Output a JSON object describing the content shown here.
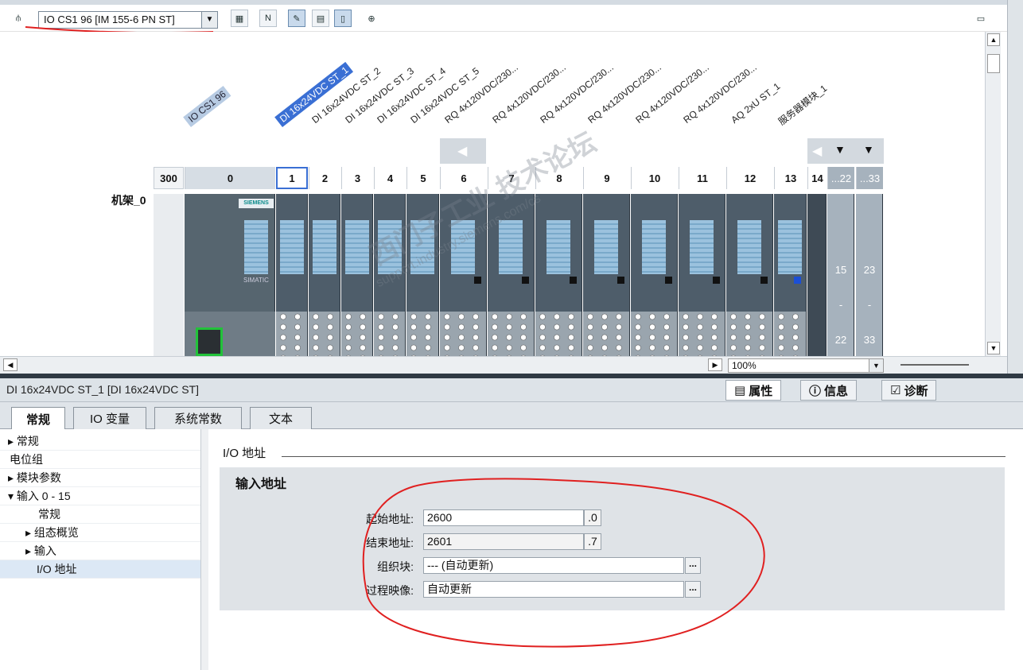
{
  "toolbar": {
    "device_select": "IO CS1 96 [IM 155-6 PN ST]",
    "icons": [
      "network-icon",
      "grid-icon",
      "name-icon",
      "tool-icon",
      "table-icon",
      "page-icon",
      "zoom-icon"
    ]
  },
  "canvas": {
    "rack_label": "机架_0",
    "slot_300": "300",
    "module_labels": [
      "IO CS1 96",
      "DI 16x24VDC ST_1",
      "DI 16x24VDC ST_2",
      "DI 16x24VDC ST_3",
      "DI 16x24VDC ST_4",
      "DI 16x24VDC ST_5",
      "RQ 4x120VDC/230...",
      "RQ 4x120VDC/230...",
      "RQ 4x120VDC/230...",
      "RQ 4x120VDC/230...",
      "RQ 4x120VDC/230...",
      "RQ 4x120VDC/230...",
      "AQ 2xU ST_1",
      "服务器模块_1"
    ],
    "slots": [
      "0",
      "1",
      "2",
      "3",
      "4",
      "5",
      "6",
      "7",
      "8",
      "9",
      "10",
      "11",
      "12",
      "13",
      "14",
      "...22",
      "...33"
    ],
    "right_nums_top": [
      "15",
      "23"
    ],
    "right_nums_mid": [
      "-",
      "-"
    ],
    "right_nums_bot": [
      "22",
      "33"
    ],
    "siemens_text": "SIEMENS",
    "simatic_text": "SIMATIC",
    "zoom": "100%"
  },
  "inspector": {
    "title": "DI 16x24VDC ST_1 [DI 16x24VDC ST]",
    "tabs_right": {
      "props": "属性",
      "info": "信息",
      "diag": "诊断"
    },
    "tabs": [
      "常规",
      "IO 变量",
      "系统常数",
      "文本"
    ],
    "nav": [
      "常规",
      "电位组",
      "模块参数",
      "输入 0 - 15",
      "常规",
      "组态概览",
      "输入",
      "I/O 地址"
    ],
    "section": "I/O 地址",
    "subsection": "输入地址",
    "fields": {
      "start_label": "起始地址:",
      "start_value": "2600",
      "start_bit": ".0",
      "end_label": "结束地址:",
      "end_value": "2601",
      "end_bit": ".7",
      "ob_label": "组织块:",
      "ob_value": "--- (自动更新)",
      "pi_label": "过程映像:",
      "pi_value": "自动更新",
      "dots": "..."
    }
  },
  "watermark": {
    "line1": "西门子工业 技术论坛",
    "line2": "support.industry.siemens.com/cs"
  }
}
